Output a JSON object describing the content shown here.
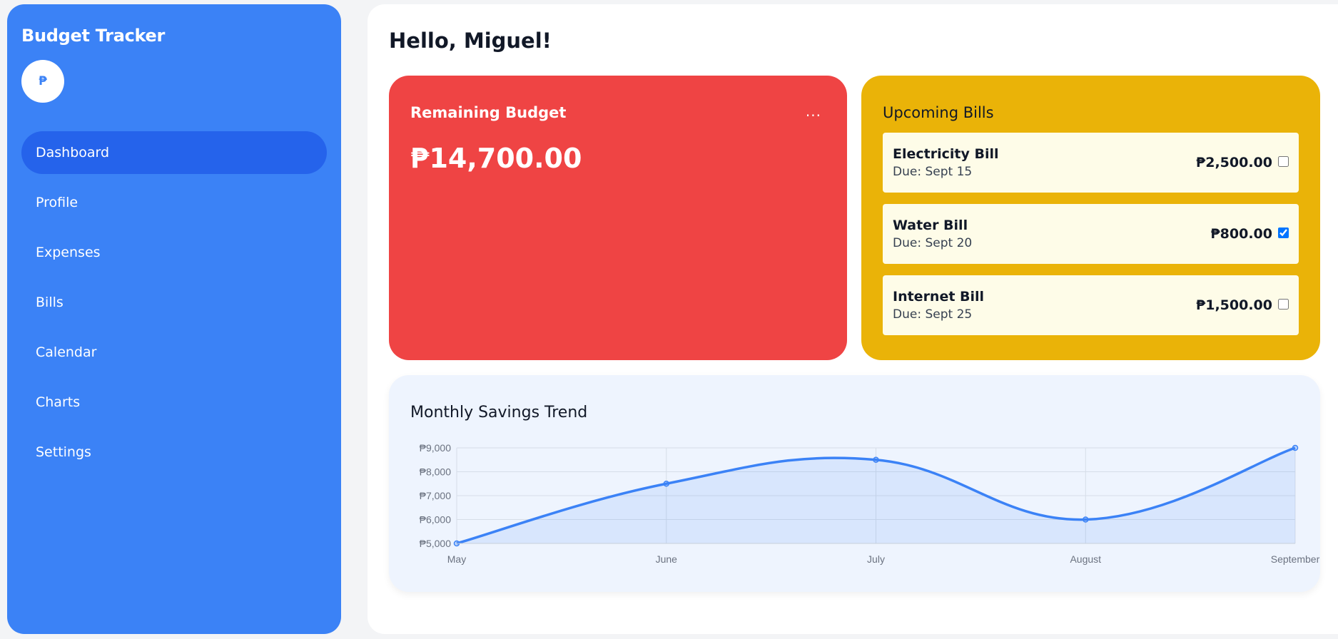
{
  "sidebar": {
    "title": "Budget Tracker",
    "logo_symbol": "₱",
    "items": [
      {
        "label": "Dashboard",
        "active": true
      },
      {
        "label": "Profile",
        "active": false
      },
      {
        "label": "Expenses",
        "active": false
      },
      {
        "label": "Bills",
        "active": false
      },
      {
        "label": "Calendar",
        "active": false
      },
      {
        "label": "Charts",
        "active": false
      },
      {
        "label": "Settings",
        "active": false
      }
    ]
  },
  "main": {
    "greeting": "Hello, Miguel!",
    "budget": {
      "title": "Remaining Budget",
      "menu_label": "...",
      "amount": "₱14,700.00"
    },
    "bills": {
      "title": "Upcoming Bills",
      "items": [
        {
          "name": "Electricity Bill",
          "due": "Due: Sept 15",
          "amount": "₱2,500.00",
          "checked": false
        },
        {
          "name": "Water Bill",
          "due": "Due: Sept 20",
          "amount": "₱800.00",
          "checked": true
        },
        {
          "name": "Internet Bill",
          "due": "Due: Sept 25",
          "amount": "₱1,500.00",
          "checked": false
        }
      ]
    },
    "savings_chart_title": "Monthly Savings Trend"
  },
  "colors": {
    "sidebar": "#3b82f6",
    "nav_active": "#2563eb",
    "budget_card": "#ef4444",
    "bills_card": "#eab308",
    "bill_item": "#fefce8",
    "chart_card": "#eef4fe",
    "line": "#3b82f6"
  },
  "chart_data": {
    "type": "line",
    "title": "Monthly Savings Trend",
    "categories": [
      "May",
      "June",
      "July",
      "August",
      "September"
    ],
    "series": [
      {
        "values": [
          5000,
          7500,
          8500,
          6000,
          9000
        ]
      }
    ],
    "ylim": [
      5000,
      9000
    ],
    "y_ticks": [
      "₱5,000",
      "₱6,000",
      "₱7,000",
      "₱8,000",
      "₱9,000"
    ],
    "y_tick_values": [
      5000,
      6000,
      7000,
      8000,
      9000
    ],
    "grid": true,
    "filled": true,
    "smooth": true
  }
}
